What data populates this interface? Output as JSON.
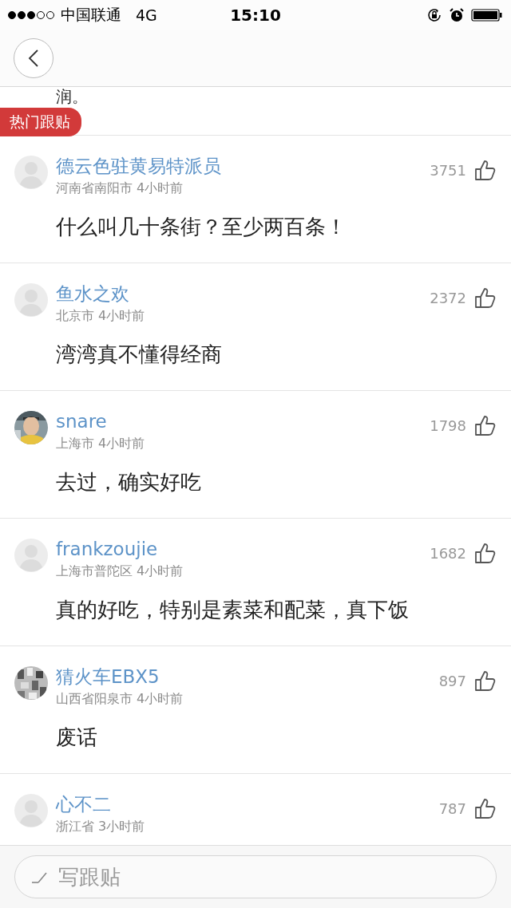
{
  "status_bar": {
    "carrier": "中国联通",
    "network": "4G",
    "time": "15:10"
  },
  "partial_text": "润。",
  "section_label": "热门跟贴",
  "comments": [
    {
      "user": "德云色驻黄易特派员",
      "avatar": {
        "kind": "default"
      },
      "meta": "河南省南阳市 4小时前",
      "likes": "3751",
      "text": "什么叫几十条街？至少两百条！"
    },
    {
      "user": "鱼水之欢",
      "avatar": {
        "kind": "default"
      },
      "meta": "北京市 4小时前",
      "likes": "2372",
      "text": "湾湾真不懂得经商"
    },
    {
      "user": "snare",
      "meta": "上海市 4小时前",
      "likes": "1798",
      "text": "去过，确实好吃"
    },
    {
      "user": "frankzoujie",
      "avatar": {
        "kind": "default"
      },
      "meta": "上海市普陀区 4小时前",
      "likes": "1682",
      "text": "真的好吃，特别是素菜和配菜，真下饭"
    },
    {
      "user": "猜火车EBX5",
      "avatar": {
        "kind": "pattern"
      },
      "meta": "山西省阳泉市 4小时前",
      "likes": "897",
      "text": "废话"
    },
    {
      "user": "心不二",
      "avatar": {
        "kind": "default"
      },
      "meta": "浙江省 3小时前",
      "likes": "787"
    }
  ],
  "reply_field": {
    "placeholder": "写跟贴"
  }
}
